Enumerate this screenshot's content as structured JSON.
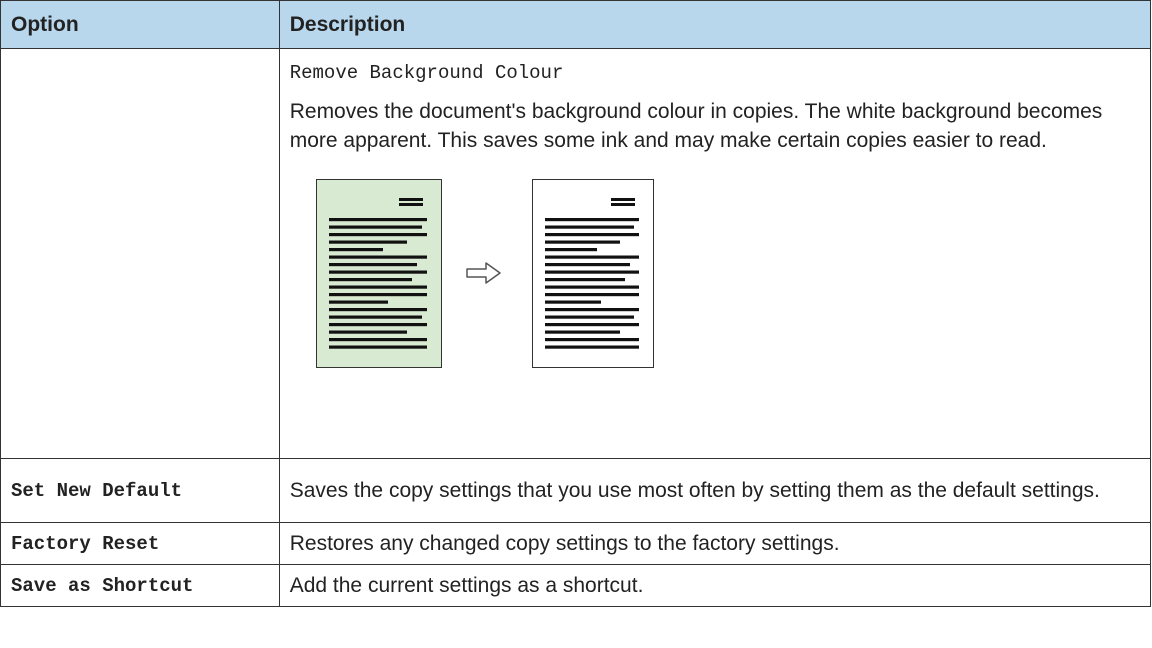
{
  "header": {
    "option": "Option",
    "description": "Description"
  },
  "rows": [
    {
      "option": "",
      "subtitle": "Remove Background Colour",
      "description": "Removes the document's background colour in copies. The white background becomes more apparent. This saves some ink and may make certain copies easier to read."
    },
    {
      "option": "Set New Default",
      "description": "Saves the copy settings that you use most often by setting them as the default settings."
    },
    {
      "option": "Factory Reset",
      "description": "Restores any changed copy settings to the factory settings."
    },
    {
      "option": "Save as Shortcut",
      "description": "Add the current settings as a shortcut."
    }
  ],
  "colors": {
    "header_bg": "#b9d7ec",
    "before_page_bg": "#d8ead1",
    "after_page_bg": "#ffffff"
  },
  "icons": {
    "illustration": "document-background-removal",
    "arrow": "right-arrow-icon"
  }
}
